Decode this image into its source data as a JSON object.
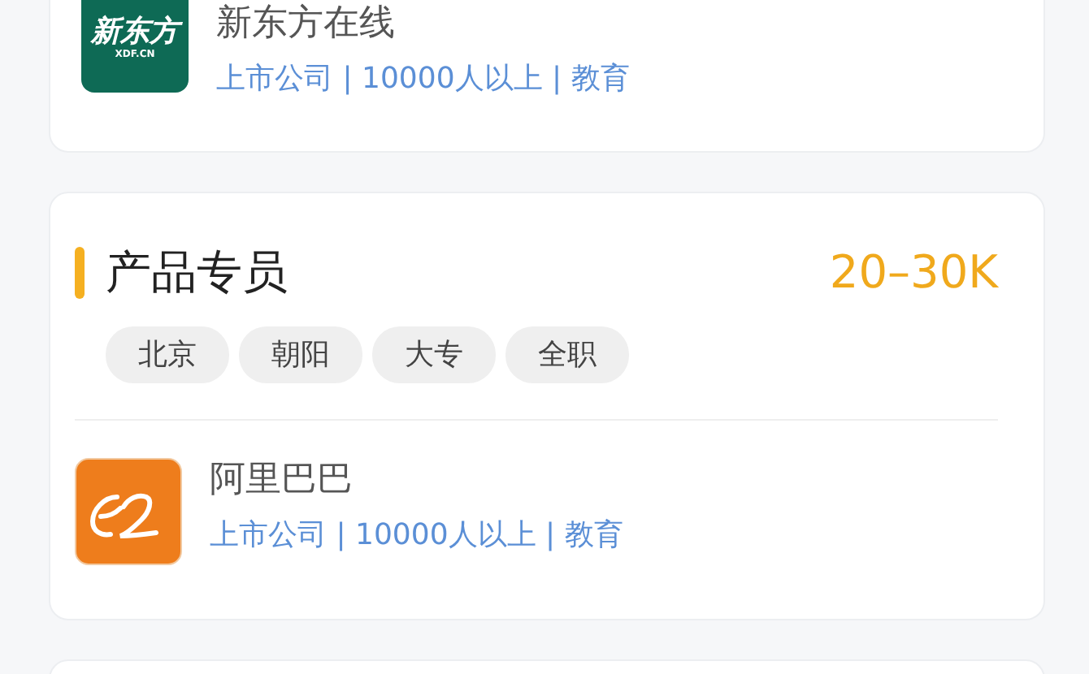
{
  "jobs": [
    {
      "company": {
        "logo": {
          "kind": "text",
          "text": "新东方",
          "subtext": "XDF.CN",
          "color": "#0e6a55"
        },
        "name": "新东方在线",
        "meta": "上市公司 | 10000人以上 | 教育"
      }
    },
    {
      "title": "产品专员",
      "salary": "20–30K",
      "tags": [
        "北京",
        "朝阳",
        "大专",
        "全职"
      ],
      "company": {
        "logo": {
          "kind": "swirl",
          "color": "#ee7d1c"
        },
        "name": "阿里巴巴",
        "meta": "上市公司 | 10000人以上 | 教育"
      }
    }
  ]
}
